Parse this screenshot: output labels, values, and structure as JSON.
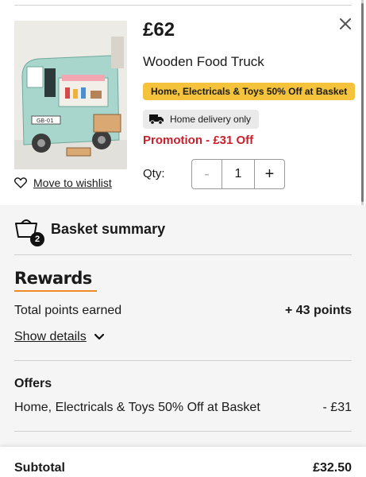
{
  "product": {
    "price": "£62",
    "name": "Wooden Food Truck",
    "promo_badge": "Home, Electricals & Toys 50% Off at Basket",
    "delivery_badge": "Home delivery only",
    "promotion": "Promotion - £31 Off",
    "qty_label": "Qty:",
    "qty_value": "1",
    "qty_minus": "-",
    "qty_plus": "+",
    "wishlist_label": "Move to wishlist",
    "image_label": "GB-01"
  },
  "summary": {
    "basket_count": "2",
    "title": "Basket summary",
    "rewards_logo": "Rewards",
    "points_label": "Total points earned",
    "points_value": "+ 43 points",
    "show_details": "Show details",
    "offers_heading": "Offers",
    "offer_label": "Home, Electricals & Toys 50% Off at Basket",
    "offer_value": "- £31",
    "subtotal_label": "Subtotal",
    "subtotal_value": "£32.50"
  },
  "colors": {
    "promo_badge_bg": "#f5c33b",
    "promotion_text": "#c8202a",
    "rewards_underline": "#f08a24"
  }
}
